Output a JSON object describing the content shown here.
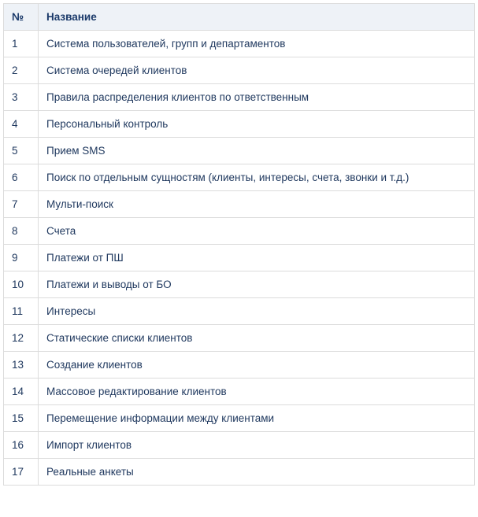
{
  "table": {
    "headers": {
      "num": "№",
      "name": "Название"
    },
    "rows": [
      {
        "num": "1",
        "name": "Система пользователей, групп и департаментов"
      },
      {
        "num": "2",
        "name": "Система очередей клиентов"
      },
      {
        "num": "3",
        "name": "Правила распределения клиентов по ответственным"
      },
      {
        "num": "4",
        "name": "Персональный контроль"
      },
      {
        "num": "5",
        "name": "Прием SMS"
      },
      {
        "num": "6",
        "name": "Поиск по отдельным сущностям (клиенты, интересы, счета, звонки и т.д.)"
      },
      {
        "num": "7",
        "name": "Мульти-поиск"
      },
      {
        "num": "8",
        "name": "Счета"
      },
      {
        "num": "9",
        "name": "Платежи от ПШ"
      },
      {
        "num": "10",
        "name": "Платежи и выводы от БО"
      },
      {
        "num": "11",
        "name": "Интересы"
      },
      {
        "num": "12",
        "name": "Статические списки клиентов"
      },
      {
        "num": "13",
        "name": "Создание клиентов"
      },
      {
        "num": "14",
        "name": "Массовое редактирование клиентов"
      },
      {
        "num": "15",
        "name": "Перемещение информации между клиентами"
      },
      {
        "num": "16",
        "name": "Импорт клиентов"
      },
      {
        "num": "17",
        "name": "Реальные анкеты"
      }
    ]
  }
}
